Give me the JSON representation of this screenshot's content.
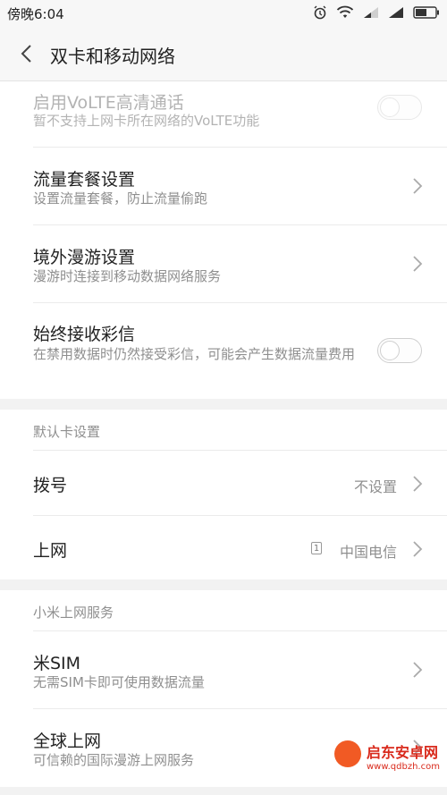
{
  "status_bar": {
    "time": "傍晚6:04",
    "icons": [
      "alarm-icon",
      "wifi-icon",
      "signal-icon",
      "signal-icon",
      "battery-icon"
    ]
  },
  "title_bar": {
    "title": "双卡和移动网络",
    "back_icon": "back-arrow-icon"
  },
  "settings": {
    "volte": {
      "title": "启用VoLTE高清通话",
      "subtitle": "暂不支持上网卡所在网络的VoLTE功能",
      "enabled": false,
      "disabled": true
    },
    "data_plan": {
      "title": "流量套餐设置",
      "subtitle": "设置流量套餐，防止流量偷跑"
    },
    "roaming": {
      "title": "境外漫游设置",
      "subtitle": "漫游时连接到移动数据网络服务"
    },
    "mms": {
      "title": "始终接收彩信",
      "subtitle": "在禁用数据时仍然接受彩信，可能会产生数据流量费用",
      "enabled": false
    }
  },
  "default_card": {
    "header": "默认卡设置",
    "dial": {
      "title": "拨号",
      "value": "不设置"
    },
    "data": {
      "title": "上网",
      "sim_slot": "1",
      "value": "中国电信"
    }
  },
  "mi_services": {
    "header": "小米上网服务",
    "mi_sim": {
      "title": "米SIM",
      "subtitle": "无需SIM卡即可使用数据流量"
    },
    "global": {
      "title": "全球上网",
      "subtitle": "可信赖的国际漫游上网服务"
    }
  },
  "watermark": {
    "text": "启东安卓网",
    "url": "www.qdbzh.com"
  },
  "colors": {
    "background": "#f2f2f2",
    "card": "#ffffff",
    "primary_text": "#222222",
    "secondary_text": "#8f8f8f",
    "watermark": "#d92a1c"
  }
}
